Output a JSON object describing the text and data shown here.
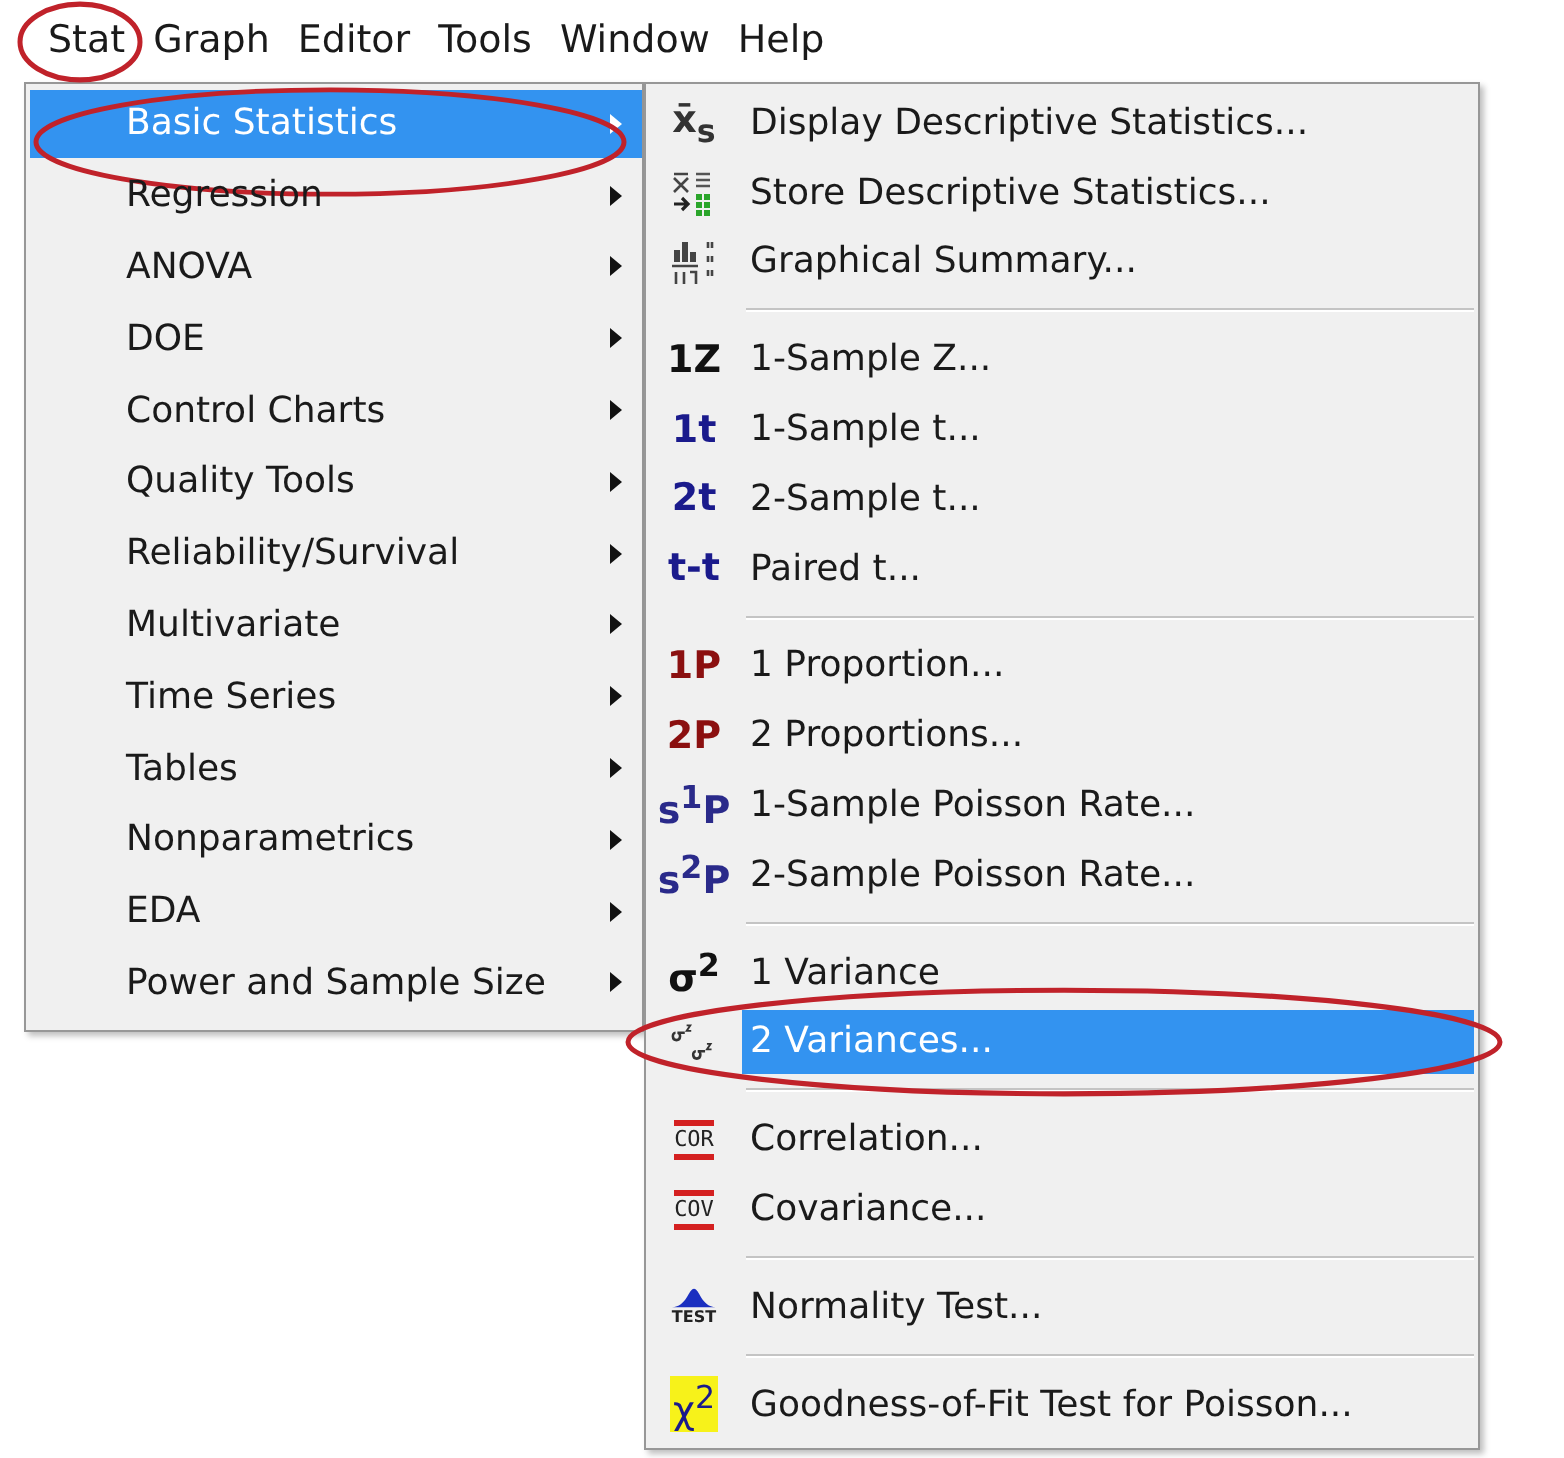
{
  "menubar": [
    {
      "label": "Stat",
      "circled": true
    },
    {
      "label": "Graph",
      "circled": false
    },
    {
      "label": "Editor",
      "circled": false
    },
    {
      "label": "Tools",
      "circled": false
    },
    {
      "label": "Window",
      "circled": false
    },
    {
      "label": "Help",
      "circled": false
    }
  ],
  "stat_menu": [
    {
      "label": "Basic Statistics",
      "selected": true,
      "circled": true
    },
    {
      "label": "Regression",
      "selected": false,
      "circled": false
    },
    {
      "label": "ANOVA",
      "selected": false,
      "circled": false
    },
    {
      "label": "DOE",
      "selected": false,
      "circled": false
    },
    {
      "label": "Control Charts",
      "selected": false,
      "circled": false
    },
    {
      "label": "Quality Tools",
      "selected": false,
      "circled": false
    },
    {
      "label": "Reliability/Survival",
      "selected": false,
      "circled": false
    },
    {
      "label": "Multivariate",
      "selected": false,
      "circled": false
    },
    {
      "label": "Time Series",
      "selected": false,
      "circled": false
    },
    {
      "label": "Tables",
      "selected": false,
      "circled": false
    },
    {
      "label": "Nonparametrics",
      "selected": false,
      "circled": false
    },
    {
      "label": "EDA",
      "selected": false,
      "circled": false
    },
    {
      "label": "Power and Sample Size",
      "selected": false,
      "circled": false
    }
  ],
  "basic_statistics_menu": [
    {
      "kind": "glyph",
      "label": "Display Descriptive Statistics...",
      "icon_text": "x̄$_{s}$",
      "color": "#333333",
      "selected": false,
      "circled": false
    },
    {
      "kind": "store",
      "label": "Store Descriptive Statistics...",
      "selected": false,
      "circled": false
    },
    {
      "kind": "summary",
      "label": "Graphical Summary...",
      "selected": false,
      "circled": false
    },
    {
      "kind": "separator"
    },
    {
      "kind": "glyph",
      "label": "1-Sample Z...",
      "icon_text": "1Z",
      "color": "#111111",
      "selected": false,
      "circled": false
    },
    {
      "kind": "glyph",
      "label": "1-Sample t...",
      "icon_text": "1t",
      "color": "#1a1a8c",
      "selected": false,
      "circled": false
    },
    {
      "kind": "glyph",
      "label": "2-Sample t...",
      "icon_text": "2t",
      "color": "#1a1a8c",
      "selected": false,
      "circled": false
    },
    {
      "kind": "glyph",
      "label": "Paired t...",
      "icon_text": "t-t",
      "color": "#1a1a8c",
      "selected": false,
      "circled": false
    },
    {
      "kind": "separator"
    },
    {
      "kind": "glyph",
      "label": "1 Proportion...",
      "icon_text": "1P",
      "color": "#8b1010",
      "selected": false,
      "circled": false
    },
    {
      "kind": "glyph",
      "label": "2 Proportions...",
      "icon_text": "2P",
      "color": "#8b1010",
      "selected": false,
      "circled": false
    },
    {
      "kind": "glyph",
      "label": "1-Sample Poisson Rate...",
      "icon_text": "s$^{1}$P",
      "color": "#2a2a8a",
      "selected": false,
      "circled": false
    },
    {
      "kind": "glyph",
      "label": "2-Sample Poisson Rate...",
      "icon_text": "s$^{2}$P",
      "color": "#2a2a8a",
      "selected": false,
      "circled": false
    },
    {
      "kind": "separator"
    },
    {
      "kind": "glyph",
      "label": "1 Variance",
      "icon_text": "σ$^{2}$",
      "color": "#111111",
      "selected": false,
      "circled": false
    },
    {
      "kind": "variances",
      "label": "2 Variances...",
      "selected": true,
      "circled": true
    },
    {
      "kind": "separator"
    },
    {
      "kind": "framed",
      "label": "Correlation...",
      "icon_text": "COR",
      "selected": false,
      "circled": false
    },
    {
      "kind": "framed",
      "label": "Covariance...",
      "icon_text": "COV",
      "selected": false,
      "circled": false
    },
    {
      "kind": "separator"
    },
    {
      "kind": "normal",
      "label": "Normality Test...",
      "icon_text": "TEST",
      "selected": false,
      "circled": false
    },
    {
      "kind": "separator"
    },
    {
      "kind": "highlight",
      "label": "Goodness-of-Fit Test for Poisson...",
      "icon_text": "χ$^{2}$",
      "selected": false,
      "circled": false
    }
  ]
}
